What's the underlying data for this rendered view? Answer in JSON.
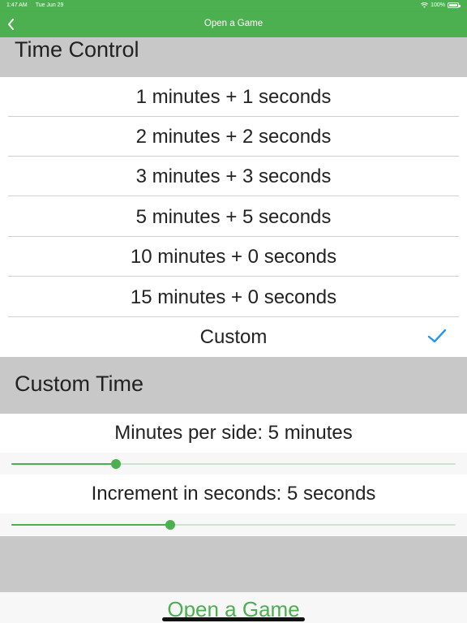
{
  "status_bar": {
    "time": "1:47 AM",
    "date": "Tue Jun 29",
    "battery": "100%"
  },
  "nav": {
    "title": "Open a Game",
    "back_icon": "chevron-left-icon"
  },
  "time_control": {
    "header": "Time Control",
    "options": [
      {
        "label": "1 minutes + 1 seconds",
        "selected": false
      },
      {
        "label": "2 minutes + 2 seconds",
        "selected": false
      },
      {
        "label": "3 minutes + 3 seconds",
        "selected": false
      },
      {
        "label": "5 minutes + 5 seconds",
        "selected": false
      },
      {
        "label": "10 minutes + 0 seconds",
        "selected": false
      },
      {
        "label": "15 minutes + 0 seconds",
        "selected": false
      },
      {
        "label": "Custom",
        "selected": true
      }
    ]
  },
  "custom_time": {
    "header": "Custom Time",
    "minutes_label": "Minutes per side: 5 minutes",
    "minutes_slider_fraction": 0.236,
    "increment_label": "Increment in seconds: 5 seconds",
    "increment_slider_fraction": 0.357
  },
  "footer": {
    "open_button": "Open a Game"
  },
  "colors": {
    "accent": "#4caf50",
    "check": "#2196f3",
    "section_bg": "#c8c8c8"
  }
}
